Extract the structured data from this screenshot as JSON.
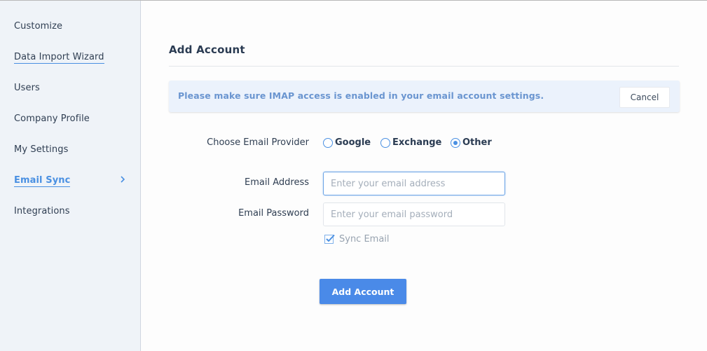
{
  "sidebar": {
    "items": [
      {
        "label": "Customize"
      },
      {
        "label": "Data Import Wizard"
      },
      {
        "label": "Users"
      },
      {
        "label": "Company Profile"
      },
      {
        "label": "My Settings"
      },
      {
        "label": "Email Sync",
        "active": true
      },
      {
        "label": "Integrations"
      }
    ],
    "active_chevron_icon": "chevron-right-icon"
  },
  "main": {
    "title": "Add Account",
    "notice": {
      "text": "Please make sure IMAP access is enabled in your email account settings.",
      "cancel_label": "Cancel"
    },
    "provider": {
      "label": "Choose Email Provider",
      "options": [
        {
          "label": "Google",
          "checked": false
        },
        {
          "label": "Exchange",
          "checked": false
        },
        {
          "label": "Other",
          "checked": true
        }
      ]
    },
    "email": {
      "label": "Email Address",
      "value": "",
      "placeholder": "Enter your email address"
    },
    "password": {
      "label": "Email Password",
      "value": "",
      "placeholder": "Enter your email password"
    },
    "sync": {
      "label": "Sync Email",
      "checked": true
    },
    "submit_label": "Add Account"
  },
  "colors": {
    "accent": "#4a90e2",
    "sidebar_bg": "#eff3f8",
    "notice_bg": "#ebf2fc",
    "notice_text": "#6a95d0",
    "primary_button": "#4a8ae8"
  }
}
